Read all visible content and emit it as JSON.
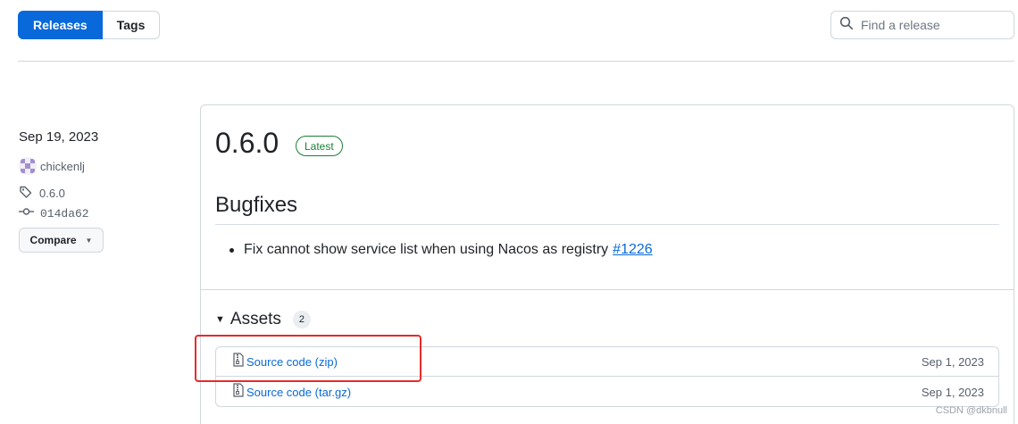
{
  "tabs": {
    "releases_label": "Releases",
    "tags_label": "Tags"
  },
  "search": {
    "placeholder": "Find a release"
  },
  "release": {
    "date": "Sep 19, 2023",
    "author": "chickenlj",
    "tag": "0.6.0",
    "commit": "014da62",
    "compare_label": "Compare",
    "title": "0.6.0",
    "badge": "Latest",
    "section_heading": "Bugfixes",
    "bugfix_text": "Fix cannot show service list when using Nacos as registry",
    "bugfix_link": "#1226",
    "assets_label": "Assets",
    "assets_count": "2",
    "assets": [
      {
        "name": "Source code",
        "ext": "(zip)",
        "date": "Sep 1, 2023"
      },
      {
        "name": "Source code",
        "ext": "(tar.gz)",
        "date": "Sep 1, 2023"
      }
    ]
  },
  "watermark": "CSDN @dkbnull",
  "colors": {
    "accent": "#0969da",
    "latest_badge": "#1a7f37",
    "highlight_box": "#e52b2b"
  },
  "icons": {
    "search": "search-icon",
    "tag": "tag-icon",
    "commit": "commit-icon",
    "zip": "file-zip-icon",
    "caret": "triangle-down-icon"
  }
}
